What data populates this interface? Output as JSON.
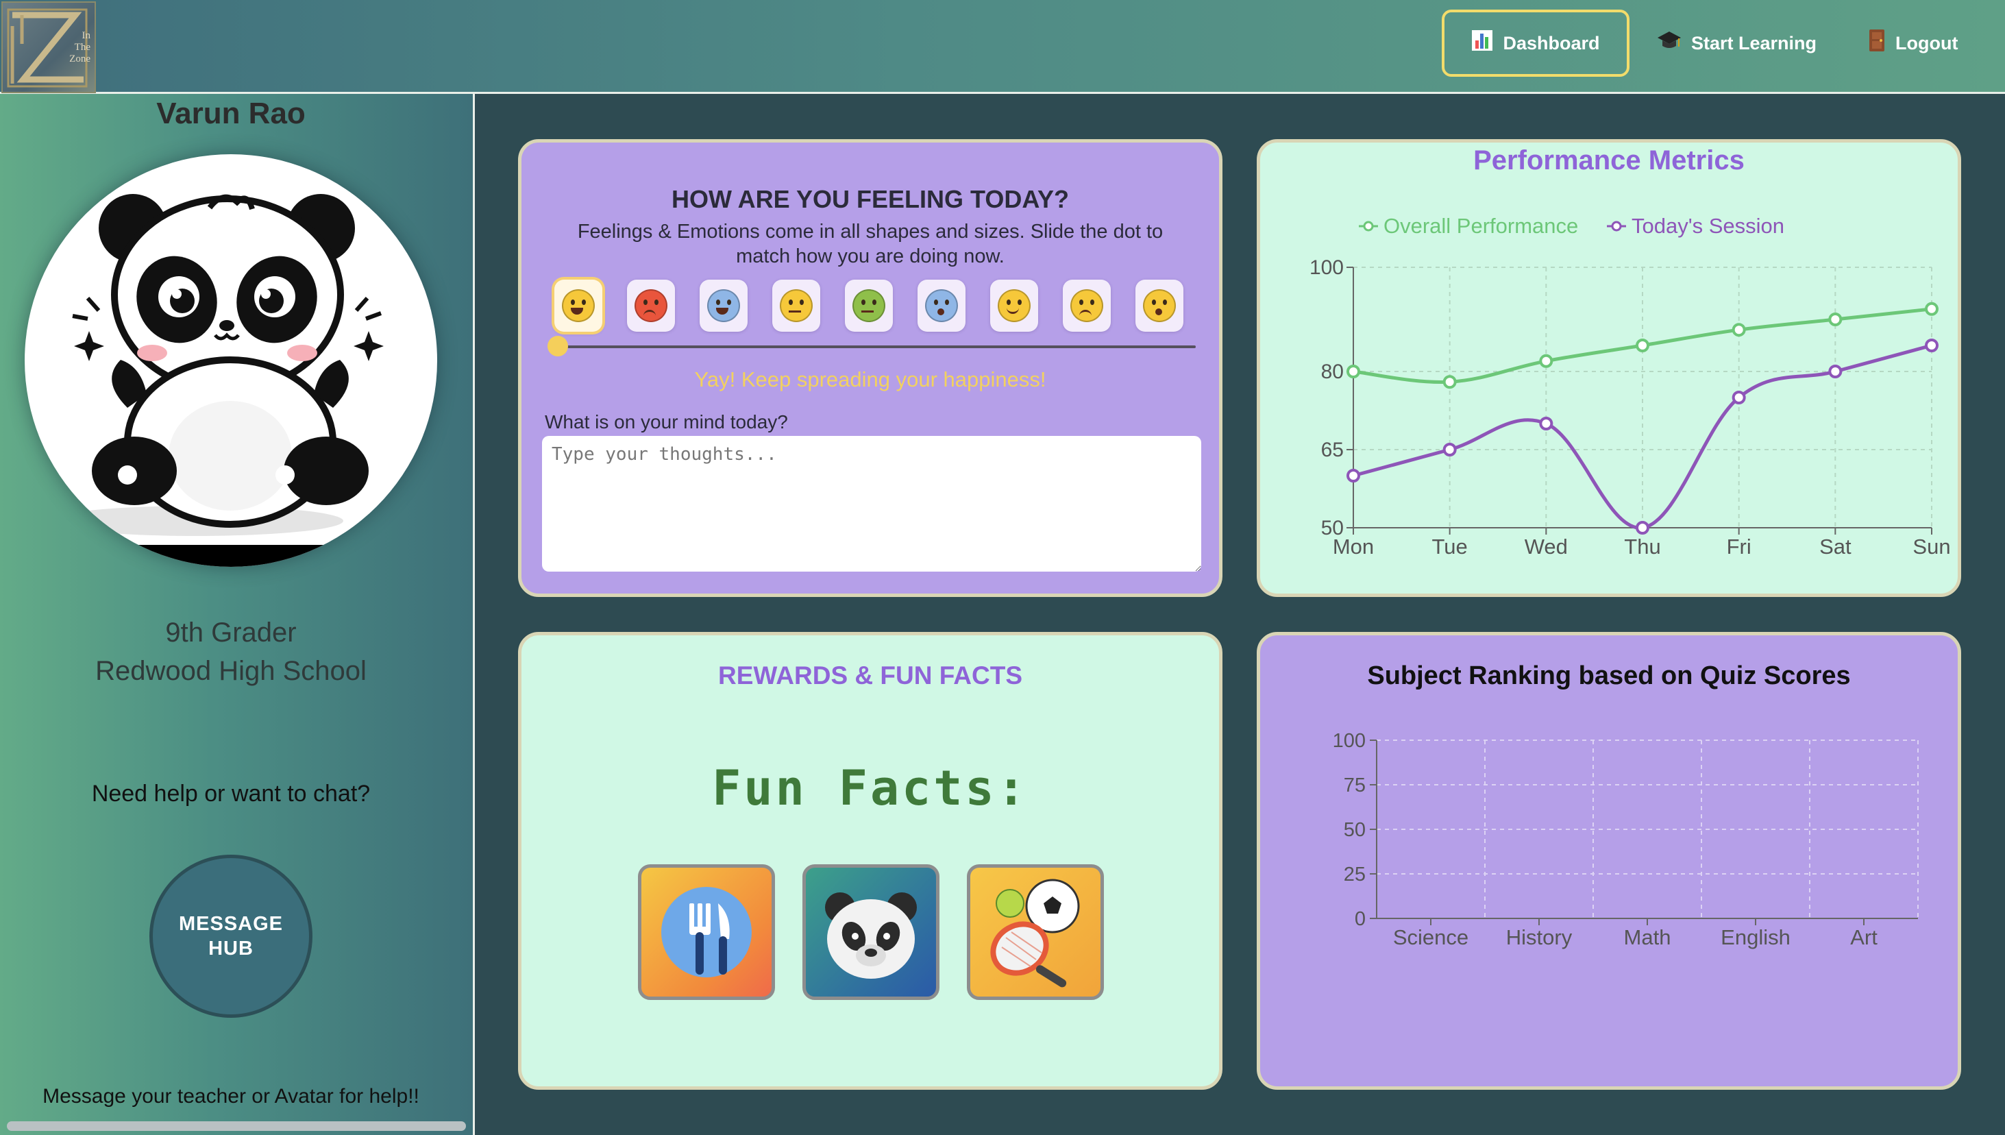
{
  "nav": {
    "logo_text": [
      "In",
      "The",
      "Zone"
    ],
    "items": [
      {
        "label": "Dashboard",
        "icon": "bar-chart-icon"
      },
      {
        "label": "Start Learning",
        "icon": "graduation-cap-icon"
      },
      {
        "label": "Logout",
        "icon": "door-icon"
      }
    ]
  },
  "profile": {
    "name": "Varun Rao",
    "avatar": "panda-avatar",
    "grade": "9th Grader",
    "school": "Redwood High School",
    "help_text": "Need help or want to chat?",
    "message_hub_label": "MESSAGE HUB",
    "message_note": "Message your teacher or Avatar for help!!"
  },
  "feelings": {
    "title": "HOW ARE YOU FEELING TODAY?",
    "description": "Feelings & Emotions come in all shapes and sizes. Slide the dot to match how you are doing now.",
    "emojis": [
      "grinning",
      "angry",
      "anxious-sweat",
      "neutral",
      "nauseated",
      "fearful",
      "slightly-smiling",
      "pensive",
      "hushed"
    ],
    "selected_index": 0,
    "slider_value": 0,
    "feedback": "Yay! Keep spreading your happiness!",
    "mind_label": "What is on your mind today?",
    "mind_placeholder": "Type your thoughts..."
  },
  "performance": {
    "title": "Performance Metrics"
  },
  "rewards": {
    "title": "REWARDS & FUN FACTS",
    "fun_facts_heading": "Fun Facts:",
    "tiles": [
      "fork-knife-icon",
      "panda-icon",
      "sports-balls-icon"
    ]
  },
  "subjects": {
    "title": "Subject Ranking based on Quiz Scores"
  },
  "chart_data": [
    {
      "type": "line",
      "title": "Performance Metrics",
      "categories": [
        "Mon",
        "Tue",
        "Wed",
        "Thu",
        "Fri",
        "Sat",
        "Sun"
      ],
      "series": [
        {
          "name": "Overall Performance",
          "color": "#6cc778",
          "values": [
            80,
            78,
            82,
            85,
            88,
            90,
            92
          ]
        },
        {
          "name": "Today's Session",
          "color": "#8e55b8",
          "values": [
            60,
            65,
            70,
            50,
            75,
            80,
            85
          ]
        }
      ],
      "yticks": [
        50,
        65,
        80,
        100
      ],
      "ylim": [
        50,
        100
      ],
      "grid": true,
      "legend": "top"
    },
    {
      "type": "bar",
      "title": "Subject Ranking based on Quiz Scores",
      "categories": [
        "Science",
        "History",
        "Math",
        "English",
        "Art"
      ],
      "values": [],
      "yticks": [
        0,
        25,
        50,
        75,
        100
      ],
      "ylim": [
        0,
        100
      ],
      "grid": true
    }
  ]
}
